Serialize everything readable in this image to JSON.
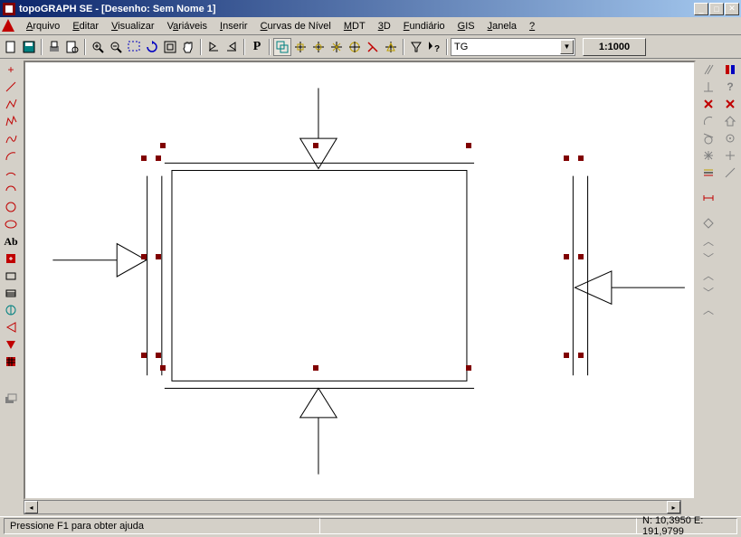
{
  "title": "topoGRAPH SE  -  [Desenho: Sem Nome 1]",
  "menu": [
    {
      "u": "A",
      "rest": "rquivo"
    },
    {
      "u": "E",
      "rest": "ditar"
    },
    {
      "u": "V",
      "rest": "isualizar"
    },
    {
      "u": "V",
      "pre": "",
      "rest": "ariáveis",
      "full": "Variáveis"
    },
    {
      "u": "I",
      "rest": "nserir"
    },
    {
      "u": "C",
      "rest": "urvas de Nível"
    },
    {
      "u": "M",
      "rest": "DT"
    },
    {
      "u": "3",
      "rest": "D"
    },
    {
      "u": "F",
      "rest": "undiário"
    },
    {
      "u": "G",
      "rest": "IS"
    },
    {
      "u": "J",
      "rest": "anela"
    },
    {
      "u": "?",
      "rest": ""
    }
  ],
  "layer_selected": "TG",
  "scale": "1:1000",
  "left_tool_label": "Ab",
  "status": {
    "help": "Pressione F1 para obter ajuda",
    "coords": "N: 10,3950 E: 191,9799"
  },
  "icons": {
    "new": "☰",
    "save": "▤",
    "print": "⎙",
    "copy": "⎘",
    "zoom_in": "🔍",
    "zoom_out": "🔍",
    "region": "▭",
    "undo": "↶",
    "redo": "↷",
    "pan": "✋",
    "prev": "◁",
    "next": "▷",
    "text": "P",
    "sel": "◫",
    "help": "❓",
    "filter": "▽",
    "point": "+"
  }
}
